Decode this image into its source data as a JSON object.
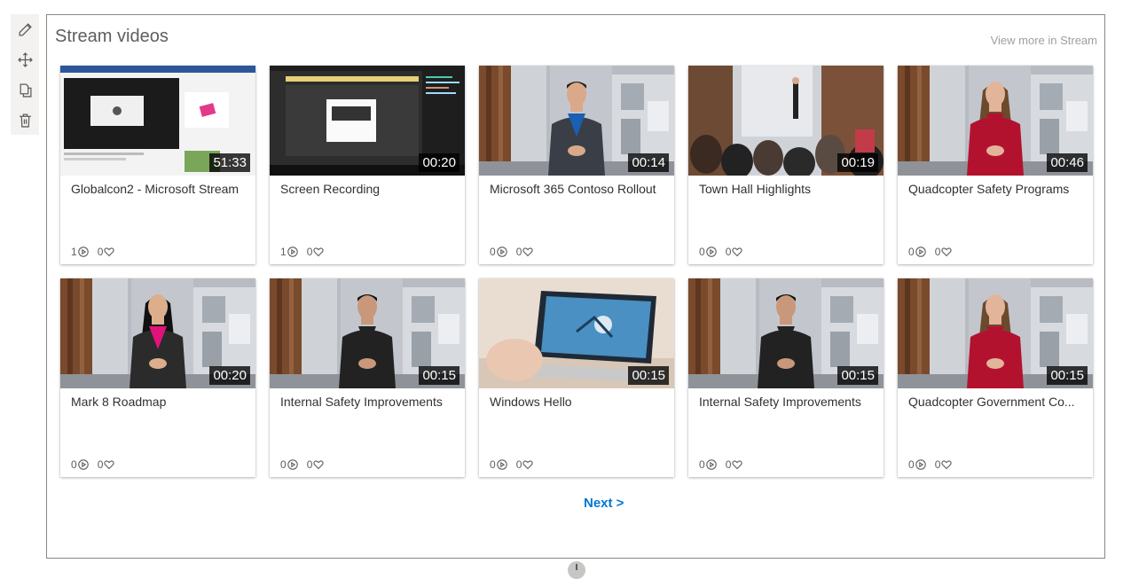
{
  "webpart": {
    "title": "Stream videos",
    "view_more": "View more in Stream",
    "next_label": "Next >"
  },
  "toolbar": {
    "items": [
      {
        "name": "edit",
        "icon": "pencil-icon"
      },
      {
        "name": "move",
        "icon": "move-icon"
      },
      {
        "name": "duplicate",
        "icon": "copy-icon"
      },
      {
        "name": "delete",
        "icon": "trash-icon"
      }
    ]
  },
  "videos": [
    {
      "title": "Globalcon2 - Microsoft Stream",
      "duration": "51:33",
      "views": "1",
      "likes": "0",
      "scene": "screen-light"
    },
    {
      "title": "Screen Recording",
      "duration": "00:20",
      "views": "1",
      "likes": "0",
      "scene": "screen-dark"
    },
    {
      "title": "Microsoft 365 Contoso Rollout",
      "duration": "00:14",
      "views": "0",
      "likes": "0",
      "scene": "presenter-blue"
    },
    {
      "title": "Town Hall Highlights",
      "duration": "00:19",
      "views": "0",
      "likes": "0",
      "scene": "audience"
    },
    {
      "title": "Quadcopter Safety Programs",
      "duration": "00:46",
      "views": "0",
      "likes": "0",
      "scene": "presenter-red"
    },
    {
      "title": "Mark 8 Roadmap",
      "duration": "00:20",
      "views": "0",
      "likes": "0",
      "scene": "presenter-pink"
    },
    {
      "title": "Internal Safety Improvements",
      "duration": "00:15",
      "views": "0",
      "likes": "0",
      "scene": "presenter-black"
    },
    {
      "title": "Windows Hello",
      "duration": "00:15",
      "views": "0",
      "likes": "0",
      "scene": "laptop"
    },
    {
      "title": "Internal Safety Improvements",
      "duration": "00:15",
      "views": "0",
      "likes": "0",
      "scene": "presenter-black"
    },
    {
      "title": "Quadcopter Government Co...",
      "duration": "00:15",
      "views": "0",
      "likes": "0",
      "scene": "presenter-red"
    }
  ],
  "colors": {
    "accent": "#0078d4",
    "card_shadow": "#c8c6c4",
    "duration_bg": "#000000"
  }
}
